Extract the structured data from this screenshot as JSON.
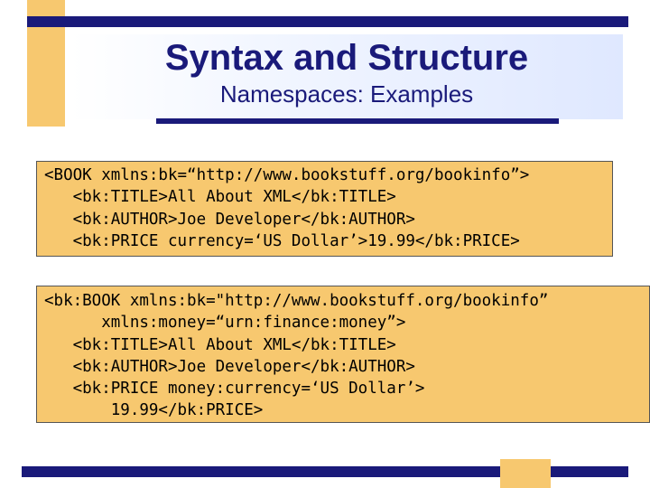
{
  "slide": {
    "title": "Syntax and Structure",
    "subtitle": "Namespaces: Examples"
  },
  "code_blocks": [
    {
      "lines": [
        "<BOOK xmlns:bk=“http://www.bookstuff.org/bookinfo”>",
        "   <bk:TITLE>All About XML</bk:TITLE>",
        "   <bk:AUTHOR>Joe Developer</bk:AUTHOR>",
        "   <bk:PRICE currency=‘US Dollar’>19.99</bk:PRICE>"
      ]
    },
    {
      "lines": [
        "<bk:BOOK xmlns:bk=\"http://www.bookstuff.org/bookinfo”",
        "      xmlns:money=“urn:finance:money”>",
        "   <bk:TITLE>All About XML</bk:TITLE>",
        "   <bk:AUTHOR>Joe Developer</bk:AUTHOR>",
        "   <bk:PRICE money:currency=‘US Dollar’>",
        "       19.99</bk:PRICE>"
      ]
    }
  ],
  "colors": {
    "accent_navy": "#1a1a7a",
    "accent_gold": "#f7c86f"
  }
}
